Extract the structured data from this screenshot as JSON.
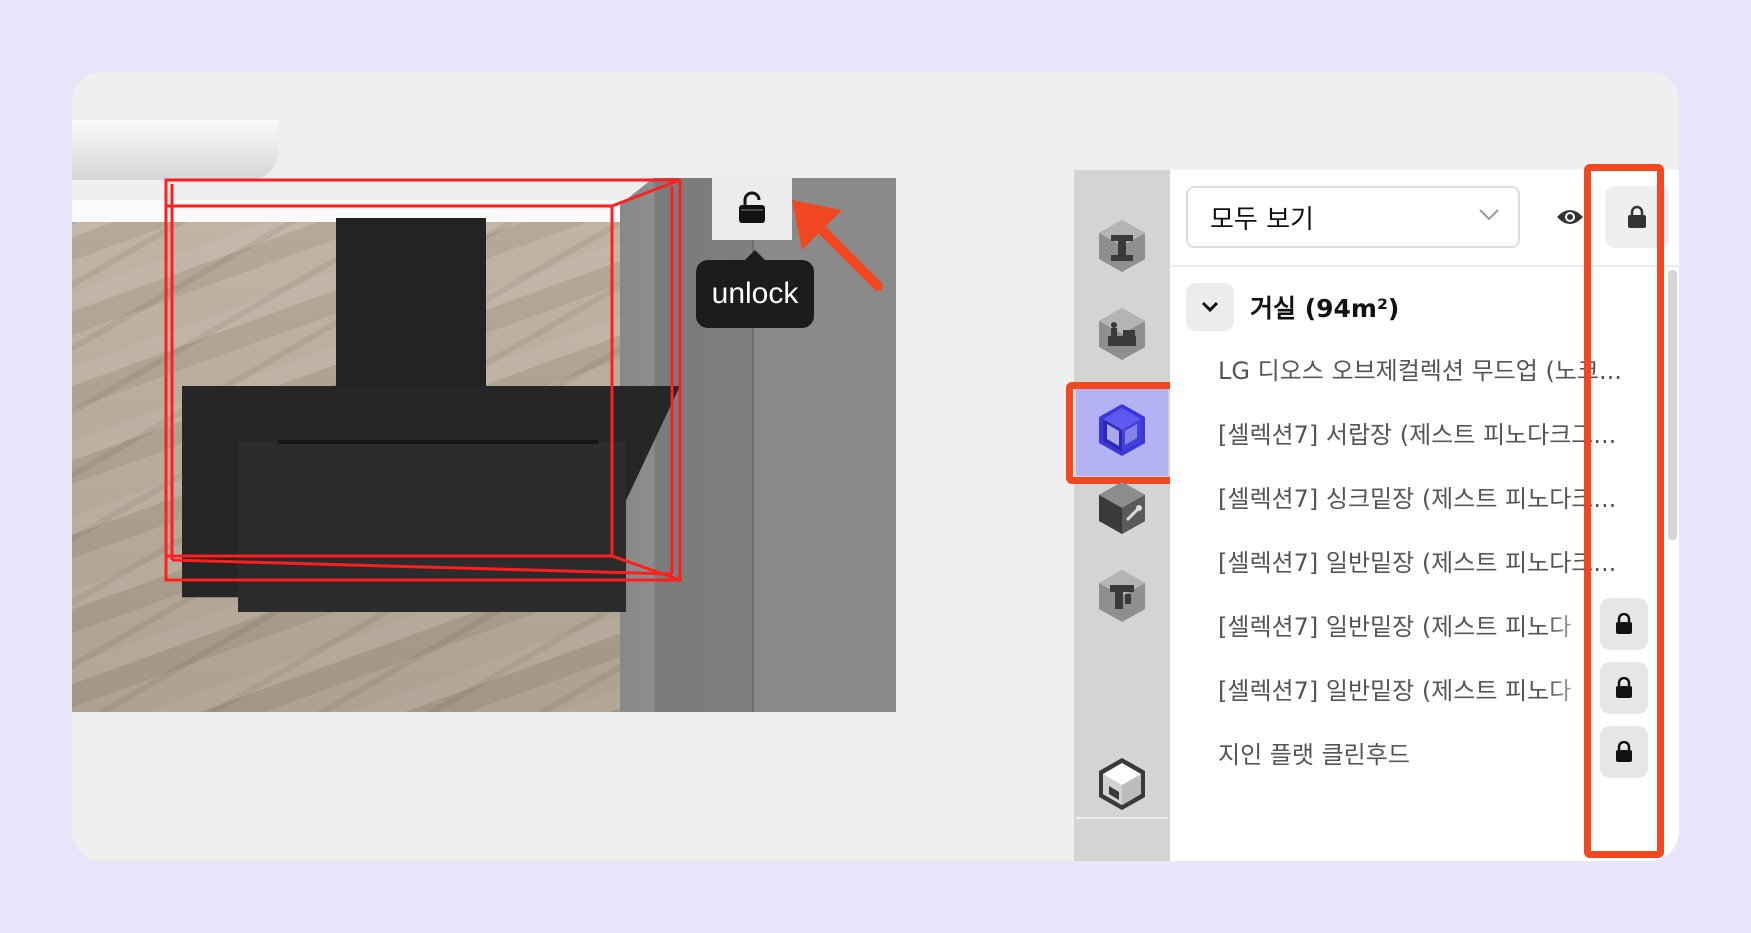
{
  "viewport": {
    "tooltip": "unlock",
    "lock_state_icon": "unlocked-padlock-icon",
    "highlight_color": "#ff1f1f",
    "annotation_color": "#f24822"
  },
  "rail": {
    "items": [
      {
        "icon": "structure-icon"
      },
      {
        "icon": "furniture-icon"
      },
      {
        "icon": "cabinet-icon",
        "selected": true
      },
      {
        "icon": "appliance-icon"
      },
      {
        "icon": "fixture-icon"
      },
      {
        "icon": "room-icon"
      }
    ]
  },
  "panel": {
    "filter_select": "모두 보기",
    "group": {
      "label": "거실 (94m²)"
    },
    "items": [
      {
        "label": "LG 디오스 오브제컬렉션 무드업 (노크...",
        "locked": false
      },
      {
        "label": "[셀렉션7] 서랍장 (제스트 피노다크그...",
        "locked": false
      },
      {
        "label": "[셀렉션7] 싱크밑장 (제스트 피노다크...",
        "locked": false
      },
      {
        "label": "[셀렉션7] 일반밑장 (제스트 피노다크...",
        "locked": false
      },
      {
        "label": "[셀렉션7] 일반밑장 (제스트 피노다",
        "locked": true
      },
      {
        "label": "[셀렉션7] 일반밑장 (제스트 피노다",
        "locked": true
      },
      {
        "label": "지인 플랫 클린후드",
        "locked": true
      }
    ]
  }
}
